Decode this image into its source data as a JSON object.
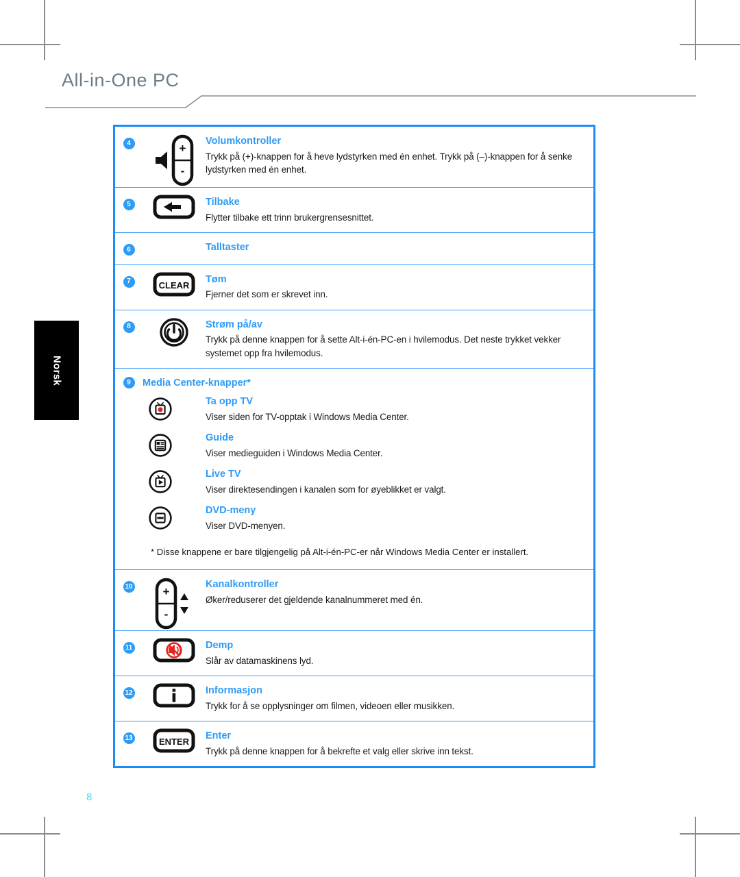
{
  "header": {
    "brand_title": "All-in-One PC"
  },
  "sidebar": {
    "language_label": "Norsk"
  },
  "page": {
    "number": "8"
  },
  "table": {
    "rows": [
      {
        "number": "4",
        "icon": "volume-rocker-icon",
        "title": "Volumkontroller",
        "desc": "Trykk på (+)-knappen for å heve lydstyrken med én enhet. Trykk på (–)-knappen for å senke lydstyrken med én enhet."
      },
      {
        "number": "5",
        "icon": "back-arrow-button-icon",
        "title": "Tilbake",
        "desc": "Flytter tilbake ett trinn brukergrensesnittet."
      },
      {
        "number": "6",
        "icon": "none",
        "title": "Talltaster",
        "desc": ""
      },
      {
        "number": "7",
        "icon": "clear-button-icon",
        "title": "Tøm",
        "desc": "Fjerner det som er skrevet inn."
      },
      {
        "number": "8",
        "icon": "power-button-icon",
        "title": "Strøm på/av",
        "desc": "Trykk på denne knappen for å sette Alt-i-én-PC-en i hvilemodus. Det neste trykket vekker systemet opp fra hvilemodus."
      }
    ],
    "media_group": {
      "number": "9",
      "title": "Media Center-knapper*",
      "items": [
        {
          "icon": "record-tv-icon",
          "title": "Ta opp TV",
          "desc": "Viser siden for TV-opptak i Windows Media Center."
        },
        {
          "icon": "guide-icon",
          "title": "Guide",
          "desc": "Viser medieguiden i Windows Media Center."
        },
        {
          "icon": "live-tv-icon",
          "title": "Live TV",
          "desc": "Viser direktesendingen i kanalen som for øyeblikket er valgt."
        },
        {
          "icon": "dvd-menu-icon",
          "title": "DVD-meny",
          "desc": "Viser DVD-menyen."
        }
      ],
      "footnote": "* Disse knappene er bare tilgjengelig på Alt-i-én-PC-er når Windows Media Center er installert."
    },
    "rows_after": [
      {
        "number": "10",
        "icon": "channel-rocker-icon",
        "title": "Kanalkontroller",
        "desc": "Øker/reduserer det gjeldende kanalnummeret med én."
      },
      {
        "number": "11",
        "icon": "mute-button-icon",
        "title": "Demp",
        "desc": "Slår av datamaskinens lyd."
      },
      {
        "number": "12",
        "icon": "info-button-icon",
        "title": "Informasjon",
        "desc": "Trykk for å se opplysninger om filmen, videoen eller musikken."
      },
      {
        "number": "13",
        "icon": "enter-button-icon",
        "title": "Enter",
        "desc": "Trykk på denne knappen for å bekrefte et valg eller skrive inn tekst."
      }
    ]
  },
  "icon_labels": {
    "clear": "CLEAR",
    "enter": "ENTER",
    "plus": "+",
    "minus": "-",
    "info": "i"
  },
  "colors": {
    "accent_blue": "#2e9bf7",
    "border_blue": "#1b8cf5",
    "title_gray": "#6b7c85",
    "page_number_cyan": "#4fd8f8",
    "record_red": "#e8231f"
  }
}
